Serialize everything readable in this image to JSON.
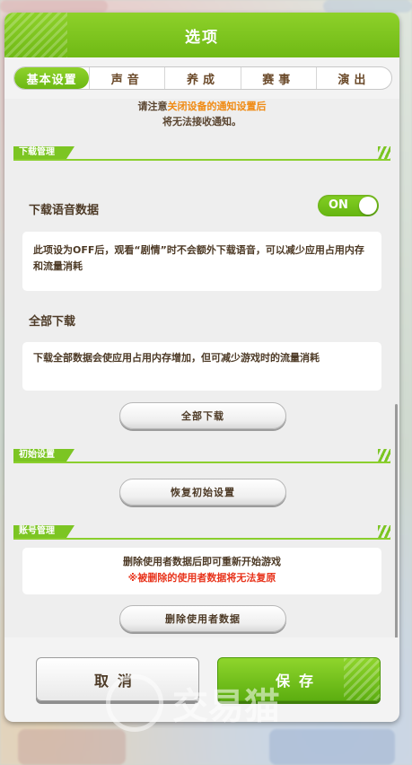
{
  "dialog": {
    "title": "选项"
  },
  "tabs": [
    {
      "label": "基本设置",
      "active": true
    },
    {
      "label": "声音"
    },
    {
      "label": "养成"
    },
    {
      "label": "赛事"
    },
    {
      "label": "演出"
    }
  ],
  "notice": {
    "prefix": "请注意",
    "highlight": "关闭设备的通知设置后",
    "line2": "将无法接收通知。"
  },
  "download": {
    "section_label": "下载管理",
    "voice_label": "下载语音数据",
    "voice_toggle": "ON",
    "voice_desc": "此项设为OFF后，观看“剧情”时不会额外下载语音，可以减少应用占用内存和流量消耗",
    "all_label": "全部下载",
    "all_desc": "下载全部数据会使应用占用内存增加，但可减少游戏时的流量消耗",
    "all_button": "全部下载"
  },
  "initial": {
    "section_label": "初始设置",
    "reset_button": "恢复初始设置"
  },
  "account": {
    "section_label": "账号管理",
    "desc_line1": "删除使用者数据后即可重新开始游戏",
    "desc_warn": "※被删除的使用者数据将无法复原",
    "delete_button": "删除使用者数据"
  },
  "footer": {
    "cancel": "取消",
    "save": "保存"
  },
  "watermark": {
    "text": "交易猫"
  },
  "colors": {
    "accent": "#7cc523",
    "notice": "#f08a12",
    "warning": "#e8341c",
    "text": "#4d3a26"
  }
}
